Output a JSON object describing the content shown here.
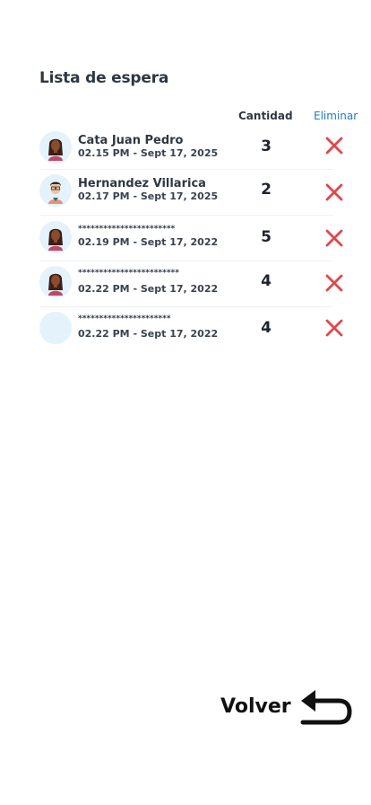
{
  "header": {
    "title": "Lista de espera"
  },
  "columns": {
    "quantity": "Cantidad",
    "delete": "Eliminar"
  },
  "entries": [
    {
      "name": "Cata Juan Pedro",
      "datetime": "02.15 PM - Sept 17, 2025",
      "quantity": "3",
      "avatar": "woman-avatar"
    },
    {
      "name": "Hernandez Villarica",
      "datetime": "02.17 PM - Sept 17, 2025",
      "quantity": "2",
      "avatar": "man-avatar"
    },
    {
      "name": "***********************",
      "datetime": "02.19 PM - Sept 17, 2022",
      "quantity": "5",
      "avatar": "woman-avatar"
    },
    {
      "name": "************************",
      "datetime": "02.22 PM - Sept 17, 2022",
      "quantity": "4",
      "avatar": "woman-avatar"
    },
    {
      "name": "**********************",
      "datetime": "02.22 PM - Sept 17, 2022",
      "quantity": "4",
      "avatar": "empty-avatar"
    }
  ],
  "footer": {
    "back_label": "Volver"
  },
  "colors": {
    "text": "#2f3743",
    "link": "#1e7bc8",
    "delete": "#e0474c",
    "avatar_bg": "#e4f2fc"
  },
  "icons": {
    "delete": "close-x-icon",
    "back": "return-arrow-icon"
  }
}
